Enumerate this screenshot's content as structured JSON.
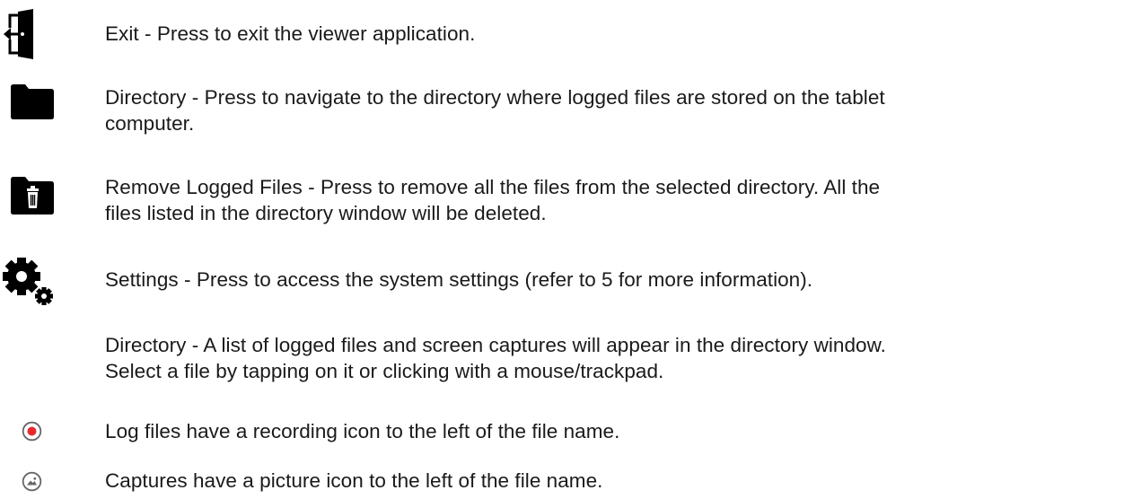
{
  "entries": [
    {
      "id": "exit",
      "icon": "exit-door-icon",
      "lines": [
        "Exit - Press to exit the viewer application."
      ]
    },
    {
      "id": "directory",
      "icon": "folder-icon",
      "lines": [
        "Directory - Press to navigate to the directory where logged files are stored on the tablet",
        "computer."
      ]
    },
    {
      "id": "remove-logged-files",
      "icon": "folder-trash-icon",
      "lines": [
        "Remove Logged Files - Press to remove all the files from the selected directory.  All the",
        "files listed in the directory window will be deleted."
      ]
    },
    {
      "id": "settings",
      "icon": "gears-icon",
      "lines": [
        "Settings - Press to access the system settings (refer to 5 for more information)."
      ]
    },
    {
      "id": "directory-list",
      "icon": "",
      "lines": [
        "Directory - A list of logged files and screen captures will appear in the directory window.",
        "Select a file by tapping on it or clicking with a mouse/trackpad."
      ]
    },
    {
      "id": "log-files",
      "icon": "recording-icon",
      "lines": [
        "Log files have a recording icon to the left of the file name."
      ]
    },
    {
      "id": "captures",
      "icon": "picture-icon",
      "lines": [
        "Captures have a picture icon to the left of the file name."
      ]
    }
  ],
  "colors": {
    "text": "#1a1a1a",
    "icon": "#000000",
    "record_dot": "#e8282b",
    "muted_icon": "#666666"
  }
}
